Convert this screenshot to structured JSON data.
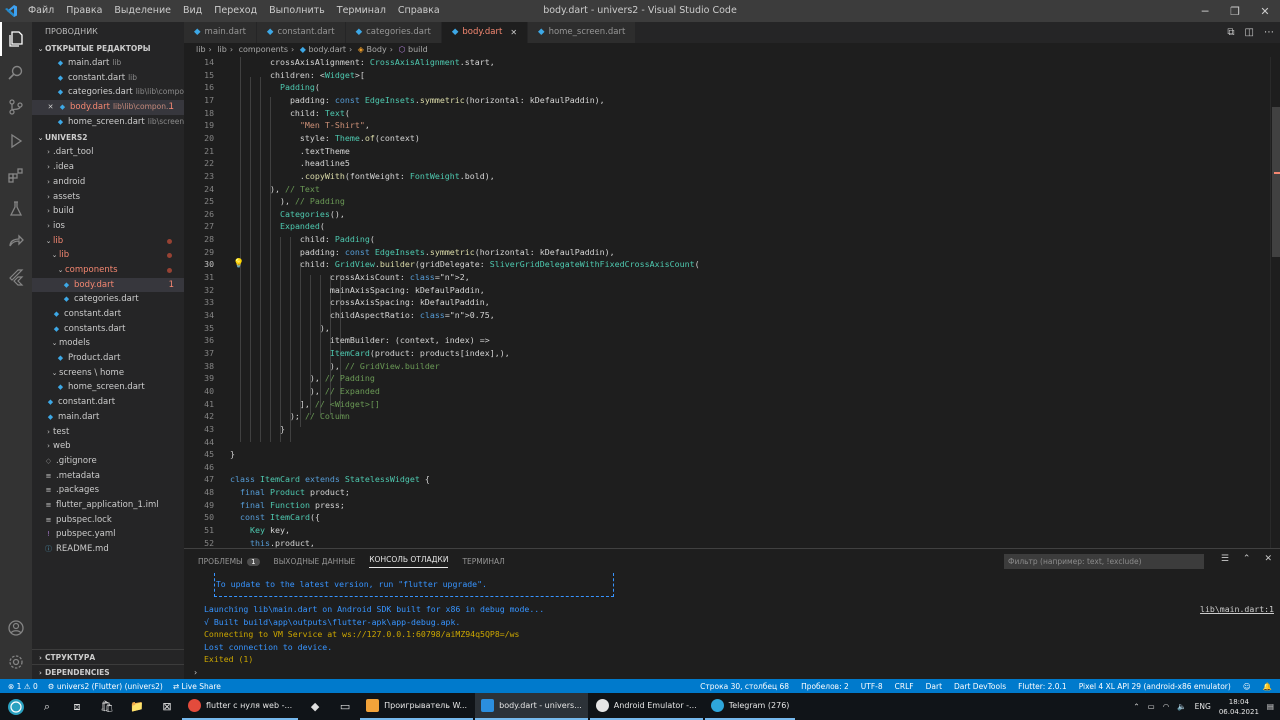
{
  "window": {
    "title": "body.dart - univers2 - Visual Studio Code",
    "menu": [
      "Файл",
      "Правка",
      "Выделение",
      "Вид",
      "Переход",
      "Выполнить",
      "Терминал",
      "Справка"
    ]
  },
  "sidebar": {
    "header": "ПРОВОДНИК",
    "open_editors_title": "ОТКРЫТЫЕ РЕДАКТОРЫ",
    "open_editors": [
      {
        "name": "main.dart",
        "path": "lib"
      },
      {
        "name": "constant.dart",
        "path": "lib"
      },
      {
        "name": "categories.dart",
        "path": "lib\\lib\\compo..."
      },
      {
        "name": "body.dart",
        "path": "lib\\lib\\compon...",
        "badge": "1"
      },
      {
        "name": "home_screen.dart",
        "path": "lib\\screens..."
      }
    ],
    "project_title": "UNIVERS2",
    "tree": [
      {
        "label": ".dart_tool"
      },
      {
        "label": ".idea"
      },
      {
        "label": "android"
      },
      {
        "label": "assets"
      },
      {
        "label": "build"
      },
      {
        "label": "ios"
      },
      {
        "label": "lib"
      },
      {
        "label": "lib"
      },
      {
        "label": "components"
      },
      {
        "label": "body.dart",
        "badge": "1"
      },
      {
        "label": "categories.dart"
      },
      {
        "label": "constant.dart"
      },
      {
        "label": "constants.dart"
      },
      {
        "label": "models"
      },
      {
        "label": "Product.dart"
      },
      {
        "label": "screens \\ home"
      },
      {
        "label": "home_screen.dart"
      },
      {
        "label": "constant.dart"
      },
      {
        "label": "main.dart"
      },
      {
        "label": "test"
      },
      {
        "label": "web"
      },
      {
        "label": ".gitignore"
      },
      {
        "label": ".metadata"
      },
      {
        "label": ".packages"
      },
      {
        "label": "flutter_application_1.iml"
      },
      {
        "label": "pubspec.lock"
      },
      {
        "label": "pubspec.yaml"
      },
      {
        "label": "README.md"
      }
    ],
    "outline_title": "СТРУКТУРА",
    "dependencies_title": "DEPENDENCIES"
  },
  "tabs": [
    "main.dart",
    "constant.dart",
    "categories.dart",
    "body.dart",
    "home_screen.dart"
  ],
  "breadcrumb": [
    "lib",
    "lib",
    "components",
    "body.dart",
    "Body",
    "build"
  ],
  "editor": {
    "line_numbers": [
      "14",
      "15",
      "16",
      "17",
      "18",
      "19",
      "20",
      "21",
      "22",
      "23",
      "24",
      "25",
      "26",
      "27",
      "28",
      "29",
      "30",
      "31",
      "32",
      "33",
      "34",
      "35",
      "36",
      "37",
      "38",
      "39",
      "40",
      "41",
      "42",
      "43",
      "44",
      "45",
      "46",
      "47",
      "48",
      "49",
      "50",
      "51",
      "52"
    ],
    "current_line": "30",
    "lines": [
      "        crossAxisAlignment: CrossAxisAlignment.start,",
      "        children: <Widget>[",
      "          Padding(",
      "            padding: const EdgeInsets.symmetric(horizontal: kDefaulPaddin),",
      "            child: Text(",
      "              \"Men T-Shirt\",",
      "              style: Theme.of(context)",
      "              .textTheme",
      "              .headline5",
      "              .copyWith(fontWeight: FontWeight.bold),",
      "        ), // Text",
      "          ), // Padding",
      "          Categories(),",
      "          Expanded(",
      "              child: Padding(",
      "              padding: const EdgeInsets.symmetric(horizontal: kDefaulPaddin),",
      "              child: GridView.builder(gridDelegate: SliverGridDelegateWithFixedCrossAxisCount(",
      "                    crossAxisCount: 2,",
      "                    mainAxisSpacing: kDefaulPaddin,",
      "                    crossAxisSpacing: kDefaulPaddin,",
      "                    childAspectRatio: 0.75,",
      "                  ),",
      "                    itemBuilder: (context, index) =>",
      "                    ItemCard(product: products[index],),",
      "                    ), // GridView.builder",
      "                ), // Padding",
      "                ), // Expanded",
      "              ], // <Widget>[]",
      "            ); // Column",
      "          }",
      "",
      "}",
      "",
      "class ItemCard extends StatelessWidget {",
      "  final Product product;",
      "  final Function press;",
      "  const ItemCard({",
      "    Key key,",
      "    this.product,"
    ]
  },
  "panel": {
    "tabs": [
      "ПРОБЛЕМЫ",
      "ВЫХОДНЫЕ ДАННЫЕ",
      "КОНСОЛЬ ОТЛАДКИ",
      "ТЕРМИНАЛ"
    ],
    "problems_count": "1",
    "filter_placeholder": "Фильтр (например: text, !exclude)",
    "output": [
      {
        "text": "  To update to the latest version, run \"flutter upgrade\".",
        "color": "#3794ff"
      },
      {
        "text": "",
        "color": "#cccccc"
      },
      {
        "text": "Launching lib\\main.dart on Android SDK built for x86 in debug mode...",
        "color": "#3794ff"
      },
      {
        "text": "√ Built build\\app\\outputs\\flutter-apk\\app-debug.apk.",
        "color": "#3794ff"
      },
      {
        "text": "Connecting to VM Service at ws://127.0.0.1:60798/aiMZ94q5QP8=/ws",
        "color": "#cca700"
      },
      {
        "text": "Lost connection to device.",
        "color": "#3794ff"
      },
      {
        "text": "Exited (1)",
        "color": "#cca700"
      }
    ],
    "source_link": "lib\\main.dart:1"
  },
  "status": {
    "errors": "1",
    "warnings": "0",
    "debug": "univers2 (Flutter) (univers2)",
    "live_share": "Live Share",
    "position": "Строка 30, столбец 68",
    "spaces": "Пробелов: 2",
    "encoding": "UTF-8",
    "eol": "CRLF",
    "language": "Dart",
    "devtools": "Dart DevTools",
    "flutter": "Flutter: 2.0.1",
    "device": "Pixel 4 XL API 29 (android-x86 emulator)"
  },
  "taskbar": {
    "apps": [
      {
        "label": "flutter с нуля web -...",
        "color": "#e34b3c"
      },
      {
        "label": "Проигрыватель W...",
        "color": "#f2a33a"
      },
      {
        "label": "body.dart - univers...",
        "color": "#2b8ede"
      },
      {
        "label": "Android Emulator -...",
        "color": "#e6e6e6"
      },
      {
        "label": "Telegram (276)",
        "color": "#2ea6db"
      }
    ],
    "lang": "ENG",
    "time": "18:04",
    "date": "06.04.2021"
  },
  "colors": {
    "accent": "#007acc",
    "editor_bg": "#1e1e1e",
    "error": "#f48771"
  }
}
